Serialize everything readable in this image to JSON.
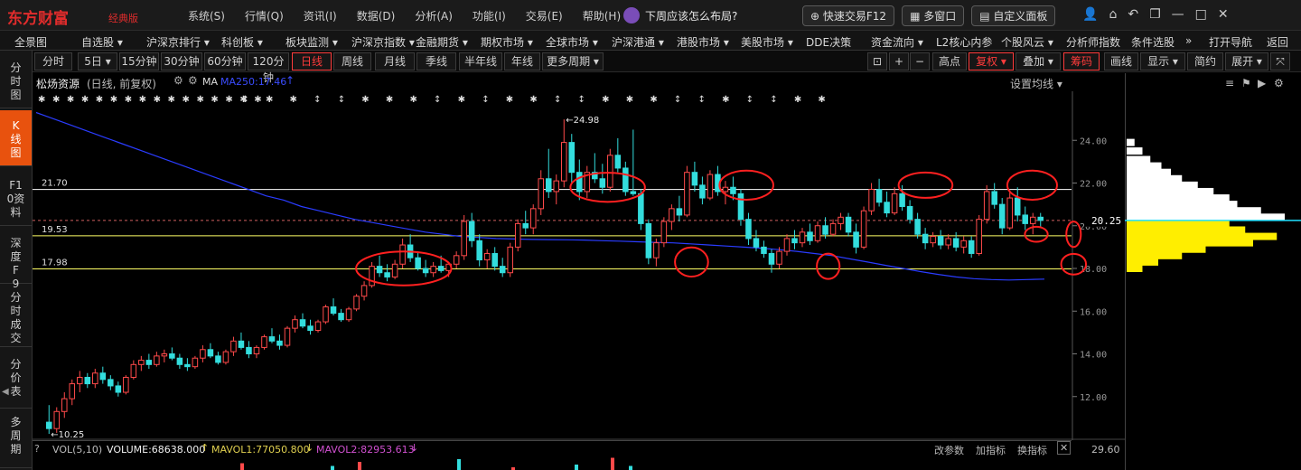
{
  "topbar": {
    "logo": "东方财富",
    "logo_sub": "经典版",
    "menu": [
      "系统(S)",
      "行情(Q)",
      "资讯(I)",
      "数据(D)",
      "分析(A)",
      "功能(I)",
      "交易(E)",
      "帮助(H)"
    ],
    "promo": "下周应该怎么布局?",
    "quick_trade": "快速交易F12",
    "multi_window": "多窗口",
    "custom_panel": "自定义面板",
    "window_icons": [
      "user-icon",
      "home-icon",
      "back-icon",
      "restore-icon",
      "minimize-icon",
      "maximize-icon",
      "close-icon"
    ]
  },
  "navbar": {
    "items": [
      "全景图",
      "自选股 ▾",
      "沪深京排行 ▾",
      "科创板 ▾",
      "板块监测 ▾",
      "沪深京指数 ▾",
      "金融期货 ▾",
      "期权市场 ▾",
      "全球市场 ▾",
      "沪深港通 ▾",
      "港股市场 ▾",
      "美股市场 ▾",
      "DDE决策",
      "资金流向 ▾",
      "L2核心内参",
      "个股风云 ▾",
      "分析师指数",
      "条件选股",
      "»",
      "打开导航",
      "返回"
    ]
  },
  "sidebar": {
    "items": [
      "分时图",
      "K线图",
      "F10资料",
      "深度F9",
      "分时成交",
      "分价表",
      "多周期"
    ],
    "active": 1
  },
  "periodbar": {
    "periods": [
      "分时",
      "5日 ▾",
      "15分钟",
      "30分钟",
      "60分钟",
      "120分钟",
      "日线",
      "周线",
      "月线",
      "季线",
      "半年线",
      "年线",
      "更多周期 ▾"
    ],
    "active_index": 6,
    "tools": [
      "lock-icon",
      "plus-icon",
      "minus-icon"
    ],
    "right_labels": [
      "高点",
      "复权 ▾",
      "叠加 ▾",
      "筹码",
      "画线",
      "显示 ▾",
      "简约",
      "展开 ▾"
    ],
    "active_right": [
      "复权 ▾",
      "筹码"
    ]
  },
  "info": {
    "stock_name": "松炀资源",
    "mode": "(日线, 前复权)",
    "ma_label": "MA",
    "ma250": "MA250:17.46",
    "ma_arrow": "↑",
    "settings": "设置均线 ▾"
  },
  "volume": {
    "label": "VOL(5,10)",
    "volume": "VOLUME:68638.000",
    "mavol1": "MAVOL1:77050.800",
    "mavol2": "MAVOL2:82953.613",
    "change_param": "改参数",
    "add_indicator": "加指标",
    "switch_indicator": "换指标",
    "right_value": "29.60"
  },
  "chart_data": {
    "type": "candlestick",
    "y_ticks": [
      "24.00",
      "22.00",
      "20.00",
      "18.00",
      "16.00",
      "14.00",
      "12.00"
    ],
    "ylim": [
      10.0,
      26.0
    ],
    "current_price": "20.25",
    "high_label": "24.98",
    "low_label": "10.25",
    "levels": [
      {
        "label": "21.70",
        "value": 21.7,
        "color": "#ffffff"
      },
      {
        "label": "19.53",
        "value": 19.53,
        "color": "#ffff66"
      },
      {
        "label": "17.98",
        "value": 17.98,
        "color": "#ffff66"
      }
    ],
    "ma250_color": "#2a3cff",
    "up_color": "#ff4a4a",
    "down_color": "#33dddd",
    "candles": [
      [
        10.8,
        11.6,
        10.25,
        10.5
      ],
      [
        10.5,
        11.5,
        10.3,
        11.3
      ],
      [
        11.3,
        12.2,
        11.0,
        11.9
      ],
      [
        11.9,
        12.8,
        11.6,
        12.6
      ],
      [
        12.6,
        13.2,
        12.2,
        12.9
      ],
      [
        12.9,
        13.1,
        12.4,
        12.6
      ],
      [
        12.6,
        13.3,
        12.4,
        13.1
      ],
      [
        13.1,
        13.4,
        12.6,
        12.8
      ],
      [
        12.8,
        13.0,
        12.3,
        12.5
      ],
      [
        12.5,
        12.7,
        12.0,
        12.2
      ],
      [
        12.2,
        13.0,
        12.1,
        12.9
      ],
      [
        12.9,
        13.7,
        12.8,
        13.5
      ],
      [
        13.5,
        13.9,
        13.2,
        13.7
      ],
      [
        13.7,
        14.0,
        13.3,
        13.5
      ],
      [
        13.5,
        14.1,
        13.4,
        13.9
      ],
      [
        13.9,
        14.2,
        13.6,
        14.0
      ],
      [
        14.0,
        14.3,
        13.7,
        13.8
      ],
      [
        13.8,
        14.0,
        13.3,
        13.5
      ],
      [
        13.5,
        13.8,
        13.2,
        13.4
      ],
      [
        13.4,
        13.9,
        13.3,
        13.8
      ],
      [
        13.8,
        14.4,
        13.6,
        14.2
      ],
      [
        14.2,
        14.5,
        13.8,
        13.9
      ],
      [
        13.9,
        14.1,
        13.5,
        13.6
      ],
      [
        13.6,
        14.2,
        13.5,
        14.1
      ],
      [
        14.1,
        14.8,
        13.9,
        14.6
      ],
      [
        14.6,
        15.0,
        14.2,
        14.3
      ],
      [
        14.3,
        14.6,
        13.8,
        14.0
      ],
      [
        14.0,
        14.4,
        13.8,
        14.3
      ],
      [
        14.3,
        14.9,
        14.2,
        14.8
      ],
      [
        14.8,
        15.2,
        14.5,
        14.6
      ],
      [
        14.6,
        14.9,
        14.2,
        14.4
      ],
      [
        14.4,
        15.3,
        14.3,
        15.2
      ],
      [
        15.2,
        15.8,
        15.0,
        15.6
      ],
      [
        15.6,
        15.9,
        15.2,
        15.3
      ],
      [
        15.3,
        15.6,
        14.9,
        15.1
      ],
      [
        15.1,
        15.6,
        15.0,
        15.5
      ],
      [
        15.5,
        16.3,
        15.4,
        16.2
      ],
      [
        16.2,
        16.6,
        15.8,
        15.9
      ],
      [
        15.9,
        16.1,
        15.5,
        15.6
      ],
      [
        15.6,
        16.2,
        15.5,
        16.1
      ],
      [
        16.1,
        16.8,
        16.0,
        16.7
      ],
      [
        16.7,
        17.4,
        16.5,
        17.2
      ],
      [
        17.2,
        18.3,
        17.1,
        18.1
      ],
      [
        18.1,
        18.6,
        17.6,
        17.8
      ],
      [
        17.8,
        18.2,
        17.4,
        17.6
      ],
      [
        17.6,
        18.4,
        17.5,
        18.2
      ],
      [
        18.2,
        19.4,
        18.0,
        19.1
      ],
      [
        19.1,
        19.6,
        18.3,
        18.5
      ],
      [
        18.5,
        18.8,
        17.9,
        18.0
      ],
      [
        18.0,
        18.4,
        17.6,
        17.8
      ],
      [
        17.8,
        18.3,
        17.6,
        18.1
      ],
      [
        18.1,
        18.6,
        17.8,
        17.9
      ],
      [
        17.9,
        18.3,
        17.6,
        18.2
      ],
      [
        18.2,
        18.8,
        18.0,
        18.6
      ],
      [
        18.6,
        20.5,
        18.4,
        20.2
      ],
      [
        20.2,
        20.6,
        19.0,
        19.3
      ],
      [
        19.3,
        19.6,
        18.1,
        18.4
      ],
      [
        18.4,
        18.9,
        18.0,
        18.7
      ],
      [
        18.7,
        19.0,
        17.9,
        18.1
      ],
      [
        18.1,
        18.5,
        17.6,
        17.8
      ],
      [
        17.8,
        19.2,
        17.6,
        19.0
      ],
      [
        19.0,
        20.3,
        18.8,
        20.1
      ],
      [
        20.1,
        20.7,
        19.6,
        19.9
      ],
      [
        19.9,
        21.0,
        19.6,
        20.8
      ],
      [
        20.8,
        22.6,
        20.5,
        22.2
      ],
      [
        22.2,
        23.6,
        21.3,
        21.6
      ],
      [
        21.6,
        22.4,
        21.0,
        22.1
      ],
      [
        22.1,
        24.98,
        21.8,
        23.9
      ],
      [
        23.9,
        24.3,
        22.0,
        22.5
      ],
      [
        22.5,
        23.1,
        21.2,
        21.6
      ],
      [
        21.6,
        22.8,
        21.3,
        22.5
      ],
      [
        22.5,
        23.4,
        22.0,
        22.2
      ],
      [
        22.2,
        22.9,
        21.5,
        21.8
      ],
      [
        21.8,
        23.6,
        21.6,
        23.3
      ],
      [
        23.3,
        24.1,
        22.5,
        22.7
      ],
      [
        22.7,
        23.0,
        21.4,
        21.6
      ],
      [
        21.6,
        24.5,
        21.4,
        21.5
      ],
      [
        21.5,
        21.7,
        19.8,
        20.1
      ],
      [
        20.1,
        20.3,
        18.2,
        18.5
      ],
      [
        18.5,
        19.4,
        18.1,
        19.2
      ],
      [
        19.2,
        20.4,
        19.0,
        20.2
      ],
      [
        20.2,
        21.0,
        19.8,
        20.8
      ],
      [
        20.8,
        21.4,
        20.2,
        20.5
      ],
      [
        20.5,
        22.8,
        20.4,
        22.5
      ],
      [
        22.5,
        23.0,
        21.6,
        21.9
      ],
      [
        21.9,
        22.3,
        21.0,
        21.3
      ],
      [
        21.3,
        22.6,
        21.2,
        22.4
      ],
      [
        22.4,
        22.8,
        21.4,
        21.6
      ],
      [
        21.6,
        22.1,
        21.0,
        21.8
      ],
      [
        21.8,
        22.3,
        21.2,
        21.5
      ],
      [
        21.5,
        21.7,
        20.0,
        20.3
      ],
      [
        20.3,
        20.6,
        19.1,
        19.4
      ],
      [
        19.4,
        19.8,
        18.8,
        19.0
      ],
      [
        19.0,
        19.3,
        18.5,
        18.7
      ],
      [
        18.7,
        18.9,
        17.8,
        18.2
      ],
      [
        18.2,
        19.0,
        18.0,
        18.8
      ],
      [
        18.8,
        19.6,
        18.6,
        19.4
      ],
      [
        19.4,
        19.8,
        18.9,
        19.2
      ],
      [
        19.2,
        19.9,
        19.0,
        19.7
      ],
      [
        19.7,
        20.1,
        19.1,
        19.3
      ],
      [
        19.3,
        20.2,
        19.2,
        20.0
      ],
      [
        20.0,
        20.4,
        19.4,
        19.6
      ],
      [
        19.6,
        20.3,
        19.5,
        20.1
      ],
      [
        20.1,
        20.6,
        19.8,
        20.4
      ],
      [
        20.4,
        20.6,
        19.5,
        19.7
      ],
      [
        19.7,
        20.1,
        18.7,
        19.0
      ],
      [
        19.0,
        20.9,
        18.9,
        20.7
      ],
      [
        20.7,
        22.0,
        20.5,
        21.7
      ],
      [
        21.7,
        22.2,
        20.9,
        21.1
      ],
      [
        21.1,
        21.6,
        20.4,
        20.6
      ],
      [
        20.6,
        21.8,
        20.5,
        21.5
      ],
      [
        21.5,
        21.9,
        20.7,
        20.9
      ],
      [
        20.9,
        21.2,
        20.1,
        20.3
      ],
      [
        20.3,
        20.6,
        19.4,
        19.6
      ],
      [
        19.6,
        19.9,
        18.9,
        19.2
      ],
      [
        19.2,
        19.7,
        19.0,
        19.5
      ],
      [
        19.5,
        19.8,
        18.9,
        19.1
      ],
      [
        19.1,
        19.6,
        18.9,
        19.4
      ],
      [
        19.4,
        19.7,
        18.8,
        19.0
      ],
      [
        19.0,
        19.5,
        18.7,
        19.3
      ],
      [
        19.3,
        19.5,
        18.5,
        18.7
      ],
      [
        18.7,
        20.5,
        18.6,
        20.3
      ],
      [
        20.3,
        21.9,
        20.1,
        21.6
      ],
      [
        21.6,
        22.0,
        20.8,
        21.0
      ],
      [
        21.0,
        21.3,
        19.6,
        19.9
      ],
      [
        19.9,
        21.6,
        19.8,
        21.3
      ],
      [
        21.3,
        21.8,
        20.2,
        20.5
      ],
      [
        20.5,
        20.9,
        19.8,
        20.1
      ],
      [
        20.1,
        20.6,
        19.6,
        20.4
      ],
      [
        20.4,
        20.6,
        19.9,
        20.25
      ]
    ],
    "ma250": [
      25.3,
      25.0,
      24.7,
      24.4,
      24.1,
      23.8,
      23.5,
      23.2,
      22.9,
      22.6,
      22.3,
      22.0,
      21.7,
      21.4,
      21.2,
      20.9,
      20.7,
      20.5,
      20.3,
      20.15,
      20.0,
      19.85,
      19.7,
      19.6,
      19.5,
      19.45,
      19.4,
      19.38,
      19.36,
      19.35,
      19.34,
      19.33,
      19.3,
      19.28,
      19.25,
      19.22,
      19.2,
      19.15,
      19.1,
      19.05,
      19.0,
      18.95,
      18.88,
      18.8,
      18.7,
      18.6,
      18.45,
      18.3,
      18.15,
      18.0,
      17.85,
      17.72,
      17.6,
      17.52,
      17.48,
      17.46,
      17.48,
      17.5
    ],
    "annotations": [
      {
        "type": "ellipse",
        "x": 0.355,
        "y": 18.0,
        "rx": 0.046,
        "ry": 0.36
      },
      {
        "type": "ellipse",
        "x": 0.552,
        "y": 21.8,
        "rx": 0.036,
        "ry": 0.31
      },
      {
        "type": "ellipse",
        "x": 0.633,
        "y": 18.3,
        "rx": 0.016,
        "ry": 0.31
      },
      {
        "type": "ellipse",
        "x": 0.686,
        "y": 21.9,
        "rx": 0.026,
        "ry": 0.31
      },
      {
        "type": "ellipse",
        "x": 0.765,
        "y": 18.1,
        "rx": 0.011,
        "ry": 0.27
      },
      {
        "type": "ellipse",
        "x": 0.859,
        "y": 21.9,
        "rx": 0.026,
        "ry": 0.27
      },
      {
        "type": "ellipse",
        "x": 0.962,
        "y": 21.9,
        "rx": 0.024,
        "ry": 0.31
      },
      {
        "type": "ellipse",
        "x": 0.966,
        "y": 19.6,
        "rx": 0.011,
        "ry": 0.16
      },
      {
        "type": "ellipse",
        "x": 1.002,
        "y": 19.6,
        "rx": 0.007,
        "ry": 0.27
      },
      {
        "type": "ellipse",
        "x": 1.002,
        "y": 18.2,
        "rx": 0.012,
        "ry": 0.22
      }
    ],
    "chip_distribution": [
      {
        "price": 23.9,
        "v": 0.05,
        "zone": "upper"
      },
      {
        "price": 23.5,
        "v": 0.1,
        "zone": "upper"
      },
      {
        "price": 23.1,
        "v": 0.15,
        "zone": "upper"
      },
      {
        "price": 22.8,
        "v": 0.22,
        "zone": "upper"
      },
      {
        "price": 22.5,
        "v": 0.28,
        "zone": "upper"
      },
      {
        "price": 22.2,
        "v": 0.35,
        "zone": "upper"
      },
      {
        "price": 21.9,
        "v": 0.45,
        "zone": "upper"
      },
      {
        "price": 21.6,
        "v": 0.55,
        "zone": "upper"
      },
      {
        "price": 21.3,
        "v": 0.65,
        "zone": "upper"
      },
      {
        "price": 21.0,
        "v": 0.7,
        "zone": "upper"
      },
      {
        "price": 20.7,
        "v": 0.85,
        "zone": "upper"
      },
      {
        "price": 20.4,
        "v": 1.0,
        "zone": "upper"
      },
      {
        "price": 20.1,
        "v": 0.65,
        "zone": "lower"
      },
      {
        "price": 19.8,
        "v": 0.75,
        "zone": "lower"
      },
      {
        "price": 19.5,
        "v": 0.95,
        "zone": "lower"
      },
      {
        "price": 19.2,
        "v": 0.8,
        "zone": "lower"
      },
      {
        "price": 18.9,
        "v": 0.5,
        "zone": "lower"
      },
      {
        "price": 18.6,
        "v": 0.35,
        "zone": "lower"
      },
      {
        "price": 18.3,
        "v": 0.2,
        "zone": "lower"
      },
      {
        "price": 18.0,
        "v": 0.1,
        "zone": "lower"
      }
    ],
    "star_markers": [
      "✱",
      "✱",
      "✱",
      "✱",
      "✱",
      "✱",
      "✱",
      "✱",
      "✱",
      "✱",
      "✱",
      "✱",
      "✱",
      "✱",
      "✱",
      "✱",
      "↕",
      "✱",
      "✱",
      "↕",
      "↕",
      "✱",
      "✱",
      "✱",
      "↕",
      "✱",
      "↕",
      "✱",
      "✱",
      "↕",
      "↕",
      "✱",
      "✱",
      "✱",
      "↕",
      "↕",
      "✱",
      "↕",
      "↕",
      "✱",
      "✱"
    ],
    "volume_bars": [
      0.5,
      0.3,
      0.6,
      0.8,
      0.2,
      0.4,
      0.9,
      0.3
    ]
  }
}
